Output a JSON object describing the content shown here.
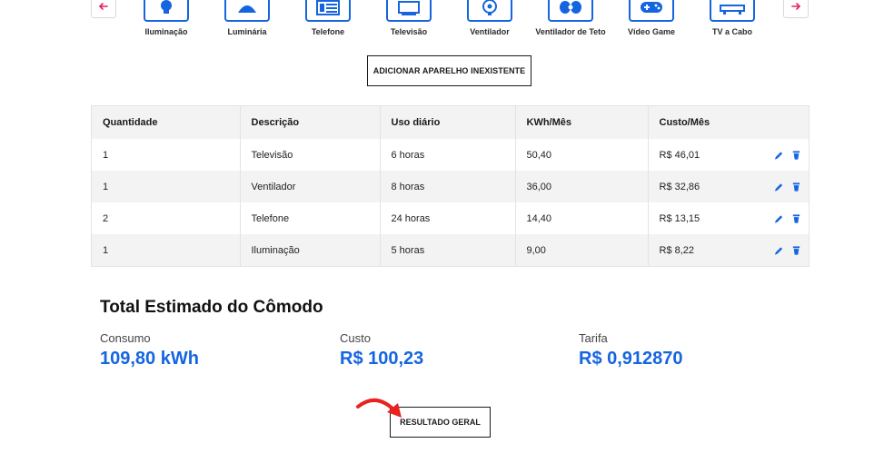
{
  "carousel": {
    "items": [
      {
        "label": "Iluminação",
        "icon": "lightbulb-icon"
      },
      {
        "label": "Luminária",
        "icon": "lamp-icon"
      },
      {
        "label": "Telefone",
        "icon": "telephone-icon"
      },
      {
        "label": "Televisão",
        "icon": "television-icon"
      },
      {
        "label": "Ventilador",
        "icon": "fan-icon"
      },
      {
        "label": "Ventilador de Teto",
        "icon": "ceiling-fan-icon"
      },
      {
        "label": "Vídeo Game",
        "icon": "gamepad-icon"
      },
      {
        "label": "TV a Cabo",
        "icon": "cable-box-icon"
      }
    ]
  },
  "add_button_label": "ADICIONAR APARELHO INEXISTENTE",
  "table": {
    "headers": [
      "Quantidade",
      "Descrição",
      "Uso diário",
      "KWh/Mês",
      "Custo/Mês"
    ],
    "rows": [
      [
        "1",
        "Televisão",
        "6 horas",
        "50,40",
        "R$ 46,01"
      ],
      [
        "1",
        "Ventilador",
        "8 horas",
        "36,00",
        "R$ 32,86"
      ],
      [
        "2",
        "Telefone",
        "24 horas",
        "14,40",
        "R$ 13,15"
      ],
      [
        "1",
        "Iluminação",
        "5 horas",
        "9,00",
        "R$ 8,22"
      ]
    ]
  },
  "totals": {
    "title": "Total Estimado do Cômodo",
    "consumo_label": "Consumo",
    "consumo_value": "109,80 kWh",
    "custo_label": "Custo",
    "custo_value": "R$ 100,23",
    "tarifa_label": "Tarifa",
    "tarifa_value": "R$ 0,912870"
  },
  "result_button_label": "RESULTADO GERAL",
  "colors": {
    "accent": "#1565e0",
    "nav_arrow": "#e0245e",
    "annotation_arrow": "#e8231f"
  }
}
